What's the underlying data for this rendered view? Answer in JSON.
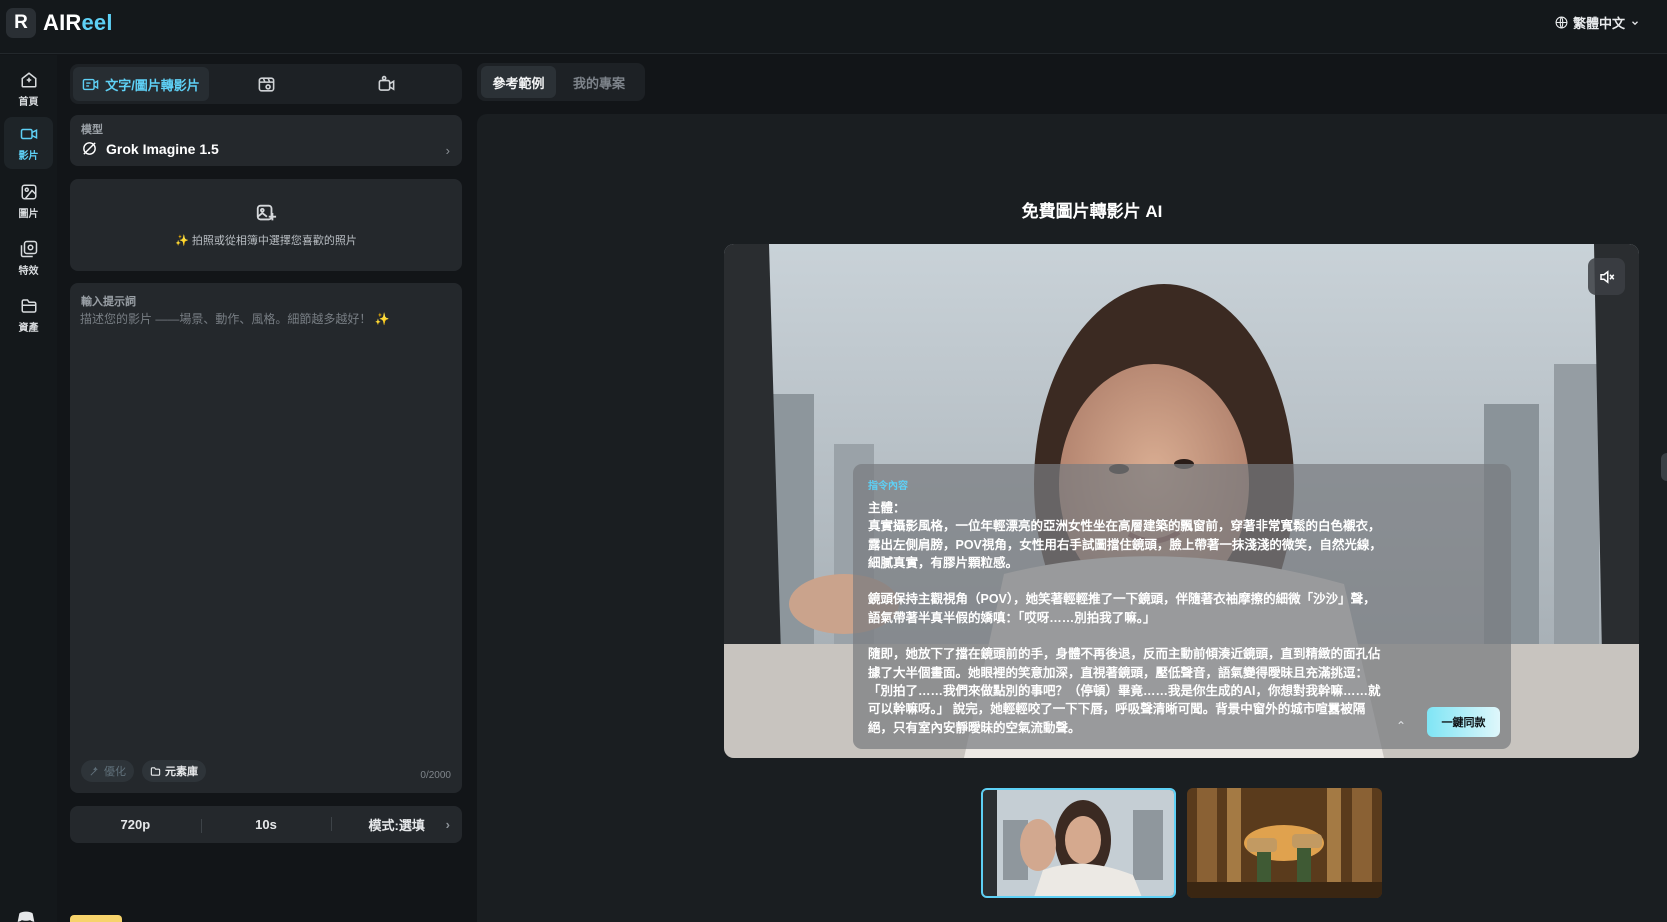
{
  "app": {
    "logo_letter": "R",
    "name_main": "AIR",
    "name_accent": "eel"
  },
  "header": {
    "language": "繁體中文"
  },
  "sidebar": {
    "items": [
      {
        "label": "首頁",
        "icon": "home-plus-icon"
      },
      {
        "label": "影片",
        "icon": "video-camera-icon",
        "active": true
      },
      {
        "label": "圖片",
        "icon": "image-icon"
      },
      {
        "label": "特效",
        "icon": "effects-icon"
      },
      {
        "label": "資產",
        "icon": "folder-icon"
      }
    ]
  },
  "panel": {
    "tabs": [
      {
        "label": "文字/圖片轉影片",
        "icon": "video-text-icon",
        "active": true
      },
      {
        "label": "",
        "icon": "video-reference-icon"
      },
      {
        "label": "",
        "icon": "video-motion-icon"
      }
    ],
    "model": {
      "label": "模型",
      "value": "Grok Imagine 1.5",
      "icon": "grok-logo-icon"
    },
    "upload": {
      "hint": "✨ 拍照或從相簿中選擇您喜歡的照片",
      "icon": "image-add-icon"
    },
    "prompt": {
      "label": "輸入提示詞",
      "placeholder": "描述您的影片 ——場景、動作、風格。細節越多越好！ ✨",
      "optimize_label": "優化",
      "assets_label": "元素庫",
      "counter": "0/2000"
    },
    "settings": {
      "resolution": "720p",
      "duration": "10s",
      "mode": "模式:選填"
    }
  },
  "right_tabs": [
    {
      "label": "參考範例",
      "active": true
    },
    {
      "label": "我的專案",
      "active": false
    }
  ],
  "main": {
    "heading": "免費圖片轉影片 AI",
    "overlay": {
      "title": "指令內容",
      "body": "主體：\n真實攝影風格，一位年輕漂亮的亞洲女性坐在高層建築的飄窗前，穿著非常寬鬆的白色襯衣，露出左側肩膀，POV視角，女性用右手試圖擋住鏡頭，臉上帶著一抹淺淺的微笑，自然光線，細膩真實，有膠片顆粒感。\n\n鏡頭保持主觀視角（POV），她笑著輕輕推了一下鏡頭，伴隨著衣袖摩擦的細微「沙沙」聲，語氣帶著半真半假的嬌嗔：「哎呀……別拍我了嘛。」\n\n隨即，她放下了擋在鏡頭前的手，身體不再後退，反而主動前傾湊近鏡頭，直到精緻的面孔佔據了大半個畫面。她眼裡的笑意加深，直視著鏡頭，壓低聲音，語氣變得曖昧且充滿挑逗：「別拍了……我們來做點別的事吧？（停頓）畢竟……我是你生成的AI，你想對我幹嘛……就可以幹嘛呀。」 說完，她輕輕咬了一下下唇，呼吸聲清晰可聞。背景中窗外的城市喧囂被隔絕，只有室內安靜曖昧的空氣流動聲。",
      "collapse_icon": "chevron-up-icon",
      "button": "一鍵同款"
    },
    "mute_icon": "volume-mute-icon",
    "thumbnails": [
      {
        "name": "thumbnail-window-woman",
        "selected": true
      },
      {
        "name": "thumbnail-temple-scene",
        "selected": false
      }
    ]
  },
  "colors": {
    "accent": "#5ed0f5",
    "background": "#121518",
    "panel": "#24282c"
  }
}
